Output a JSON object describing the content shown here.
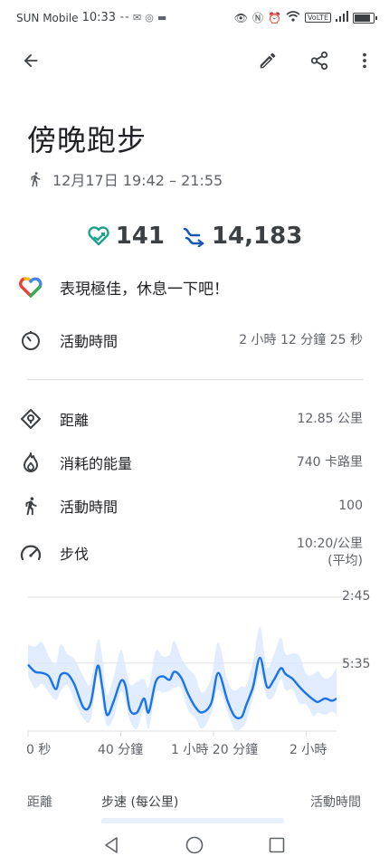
{
  "status_bar": {
    "carrier": "SUN Mobile",
    "time": "10:33",
    "volte": "VoLTE",
    "battery_level": 0.9
  },
  "activity": {
    "title": "傍晚跑步",
    "datetime": "12月17日 19:42 – 21:55"
  },
  "summary": {
    "heart_points": "141",
    "steps": "14,183"
  },
  "coach_message": "表現極佳，休息一下吧！",
  "stats": [
    {
      "icon": "timer-icon",
      "label": "活動時間",
      "value": "2 小時 12 分鐘 25 秒"
    },
    {
      "icon": "location-icon",
      "label": "距離",
      "value": "12.85 公里"
    },
    {
      "icon": "fire-icon",
      "label": "消耗的能量",
      "value": "740 卡路里"
    },
    {
      "icon": "walking-icon",
      "label": "活動時間",
      "value": "100"
    },
    {
      "icon": "speedometer-icon",
      "label": "步伐",
      "value": "10:20/公里",
      "value_note": "(平均)"
    }
  ],
  "chart_data": {
    "type": "line",
    "y_ticks": [
      "2:45",
      "5:35"
    ],
    "x_ticks": [
      "0 秒",
      "40 分鐘",
      "1 小時 20 分鐘",
      "2 小時"
    ],
    "x_unit": "minutes",
    "xlim": [
      0,
      133
    ],
    "ylim_min_per_km": [
      2.75,
      8.5
    ],
    "y_inverted": true,
    "series": [
      {
        "x": [
          0,
          3,
          6,
          9,
          12,
          14,
          17,
          20,
          24,
          27,
          30,
          32,
          34,
          37,
          40,
          42,
          44,
          47,
          50,
          52,
          55,
          58,
          61,
          63,
          66,
          69,
          72,
          75,
          79,
          82,
          86,
          89,
          92,
          94,
          97,
          100,
          103,
          106,
          109,
          111,
          114,
          117,
          120,
          123,
          125,
          128,
          131,
          133
        ],
        "y": [
          5.65,
          5.95,
          6.0,
          6.15,
          6.7,
          6.1,
          6.05,
          6.5,
          7.5,
          7.3,
          5.7,
          6.6,
          7.8,
          7.2,
          6.35,
          6.55,
          7.6,
          7.7,
          7.1,
          7.7,
          6.4,
          6.15,
          6.3,
          5.95,
          6.2,
          6.9,
          7.45,
          7.7,
          7.3,
          6.0,
          7.2,
          7.85,
          7.9,
          7.4,
          6.6,
          5.35,
          6.6,
          6.3,
          5.8,
          6.05,
          6.25,
          6.6,
          6.9,
          7.15,
          7.25,
          7.1,
          7.2,
          7.1
        ]
      }
    ],
    "band_color": "#d7e6fd",
    "line_color": "#1a73e8"
  },
  "tabs": [
    {
      "label": "距離"
    },
    {
      "label": "步速 (每公里)"
    },
    {
      "label": "活動時間"
    }
  ],
  "colors": {
    "accent": "#1a73e8",
    "heart_teal": "#1ba08c",
    "steps_blue": "#1a56b5"
  }
}
